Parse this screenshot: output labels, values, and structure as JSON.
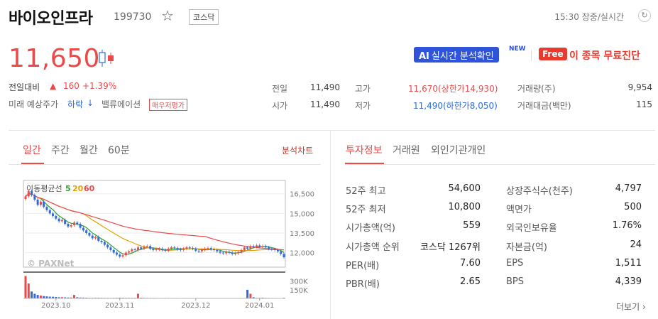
{
  "header": {
    "name": "바이오인프라",
    "code": "199730",
    "market": "코스닥",
    "time": "15:30 장중/실시간"
  },
  "price": {
    "current": "11,650",
    "change_label": "전일대비",
    "change": "160",
    "change_pct": "+1.39%",
    "forecast_label": "미래 예상주가",
    "forecast_value": "하락",
    "valuation_label": "밸류에이션",
    "valuation_tag": "매우저평가"
  },
  "promo": {
    "ai_prefix": "AI",
    "ai_label": "실시간 분석확인",
    "new": "NEW",
    "free": "Free",
    "free_text": "이 종목 무료진단"
  },
  "quote": {
    "prev_label": "전일",
    "prev_value": "11,490",
    "open_label": "시가",
    "open_value": "11,490",
    "high_label": "고가",
    "high_value": "11,670(상한가14,930)",
    "low_label": "저가",
    "low_value": "11,490(하한가8,050)",
    "volume_label": "거래량(주)",
    "volume_value": "9,954",
    "amount_label": "거래대금(백만)",
    "amount_value": "115"
  },
  "chart_tabs": {
    "tabs": [
      "일간",
      "주간",
      "월간",
      "60분"
    ],
    "active": 0,
    "analysis_link": "분석차트"
  },
  "chart_data": {
    "type": "candlestick",
    "ma_label": "이동평균선",
    "ma_periods": [
      "5",
      "20",
      "60"
    ],
    "ma_colors": [
      "#2ca02c",
      "#e6a100",
      "#e94b4b"
    ],
    "watermark": "© PAXNet",
    "y_ticks": [
      "16,500",
      "15,000",
      "13,500",
      "12,000"
    ],
    "y_tick_values": [
      16500,
      15000,
      13500,
      12000
    ],
    "ylim": [
      11000,
      17300
    ],
    "vol_ticks": [
      "300K",
      "150K"
    ],
    "vol_ylim": [
      0,
      420000
    ],
    "x_ticks": [
      "2023.10",
      "2023.11",
      "2023.12",
      "2024.01"
    ],
    "x_tick_index": [
      10,
      31,
      56,
      77
    ],
    "close": [
      16300,
      16700,
      16400,
      16050,
      15650,
      15900,
      15500,
      15250,
      15000,
      14800,
      14600,
      14400,
      14500,
      14200,
      14000,
      14100,
      14300,
      14200,
      13900,
      13700,
      13500,
      13300,
      13100,
      13200,
      12900,
      12800,
      12600,
      12400,
      12200,
      12000,
      11850,
      11700,
      11800,
      12000,
      12100,
      12250,
      12200,
      12400,
      12300,
      12450,
      12500,
      12300,
      12200,
      12250,
      12300,
      12200,
      12150,
      12300,
      12400,
      12350,
      12250,
      12200,
      12300,
      12400,
      12350,
      12300,
      12150,
      12100,
      12200,
      12300,
      12350,
      12250,
      12200,
      12100,
      12000,
      11950,
      12050,
      12000,
      11900,
      11950,
      12050,
      12200,
      12400,
      12300,
      12500,
      12450,
      12550,
      12450,
      12500,
      12400,
      12300,
      12250,
      12200,
      12100,
      11900,
      11650
    ],
    "volume": [
      390000,
      260000,
      120000,
      80000,
      60000,
      50000,
      40000,
      35000,
      30000,
      28000,
      25000,
      20000,
      22000,
      18000,
      15000,
      16000,
      60000,
      20000,
      15000,
      14000,
      12000,
      10000,
      10000,
      12000,
      11000,
      10000,
      9000,
      9000,
      8000,
      9000,
      10000,
      12000,
      11000,
      10000,
      10000,
      9000,
      9000,
      80000,
      12000,
      10000,
      9000,
      8000,
      8000,
      8000,
      7000,
      7000,
      8000,
      8000,
      7000,
      7000,
      7000,
      6000,
      7000,
      7000,
      6000,
      6000,
      6000,
      7000,
      7000,
      6000,
      6000,
      6000,
      6000,
      6000,
      6000,
      6000,
      6000,
      6000,
      6000,
      6000,
      6000,
      7000,
      7000,
      150000,
      80000,
      20000,
      10000,
      10000,
      12000,
      9000,
      8000,
      7000,
      7000,
      6000,
      6000,
      9954
    ]
  },
  "info_tabs": {
    "tabs": [
      "투자정보",
      "거래원",
      "외인기관개인"
    ],
    "active": 0
  },
  "invest": {
    "left": [
      {
        "label": "52주 최고",
        "value": "54,600"
      },
      {
        "label": "52주 최저",
        "value": "10,800"
      },
      {
        "label": "시가총액(억)",
        "value": "559"
      },
      {
        "label": "시가총액 순위",
        "value": "코스닥 1267위"
      },
      {
        "label": "PER(배)",
        "value": "7.60"
      },
      {
        "label": "PBR(배)",
        "value": "2.65"
      }
    ],
    "right": [
      {
        "label": "상장주식수(천주)",
        "value": "4,797"
      },
      {
        "label": "액면가",
        "value": "500"
      },
      {
        "label": "외국인보유율",
        "value": "1.76%"
      },
      {
        "label": "자본금(억)",
        "value": "24"
      },
      {
        "label": "EPS",
        "value": "1,511"
      },
      {
        "label": "BPS",
        "value": "4,339"
      }
    ],
    "more": "더보기"
  }
}
